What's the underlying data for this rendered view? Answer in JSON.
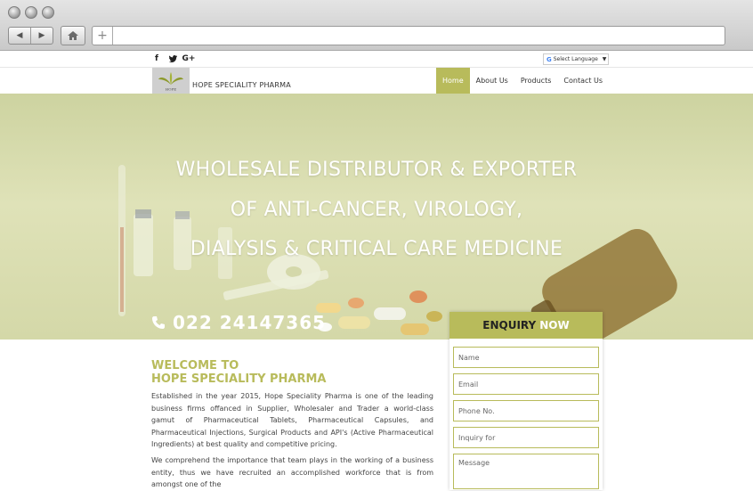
{
  "browser": {
    "back_icon": "◀",
    "forward_icon": "▶",
    "new_tab": "+"
  },
  "top": {
    "social": [
      "f",
      "✦",
      "G+"
    ],
    "translate_label": "Select Language",
    "translate_arrow": "▼"
  },
  "header": {
    "brand": "HOPE SPECIALITY PHARMA",
    "logo_caption": "HOPE",
    "nav": [
      "Home",
      "About Us",
      "Products",
      "Contact Us"
    ]
  },
  "hero": {
    "line1": "WHOLESALE DISTRIBUTOR & EXPORTER",
    "line2": "OF ANTI-CANCER, VIROLOGY,",
    "line3": "DIALYSIS & CRITICAL CARE MEDICINE",
    "phone": "022 24147365"
  },
  "enquiry": {
    "title_1": "ENQUIRY",
    "title_2": "NOW",
    "fields": [
      "Name",
      "Email",
      "Phone No.",
      "Inquiry for",
      "Message"
    ]
  },
  "content": {
    "welcome_1": "WELCOME TO",
    "welcome_2": "HOPE SPECIALITY PHARMA",
    "para1": "Established in the year 2015, Hope Speciality Pharma is one of the leading business firms offanced in Supplier, Wholesaler and Trader a world-class gamut of Pharmaceutical Tablets, Pharmaceutical Capsules, and Pharmaceutical Injections, Surgical Products and API's (Active Pharmaceutical Ingredients) at best quality and competitive pricing.",
    "para2": "We comprehend the importance that team plays in the working of a business entity, thus we have recruited an accomplished workforce that is from amongst one of the"
  },
  "colors": {
    "accent": "#b8bb5b"
  }
}
